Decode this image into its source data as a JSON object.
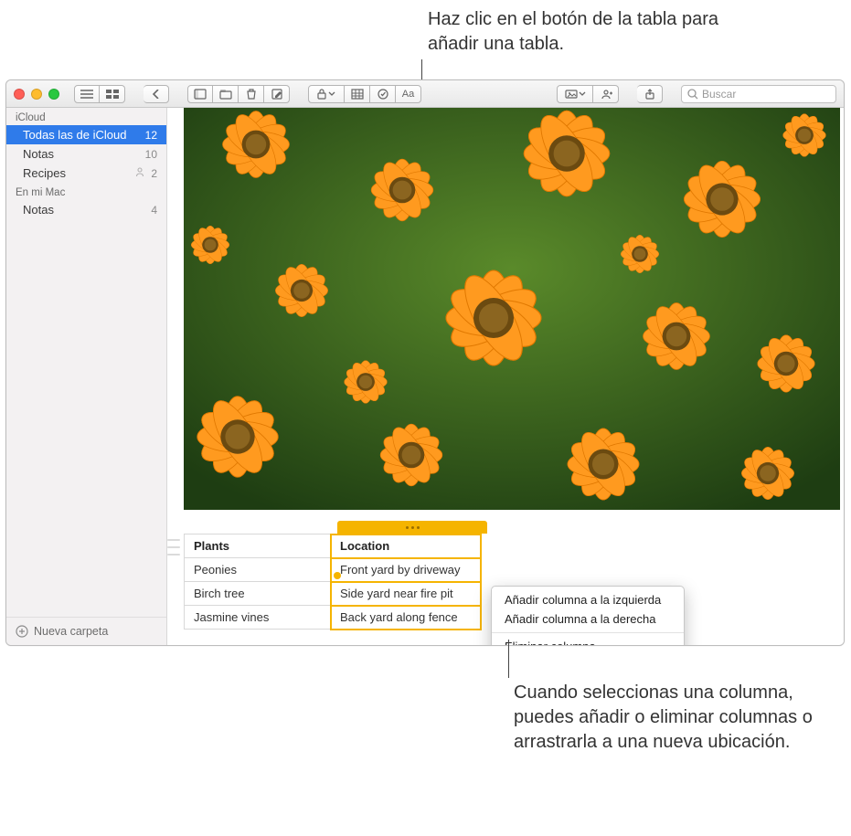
{
  "callouts": {
    "top": "Haz clic en el botón de la tabla para añadir una tabla.",
    "bottom": "Cuando seleccionas una columna, puedes añadir o eliminar columnas o arrastrarla a una nueva ubicación."
  },
  "toolbar": {
    "search_placeholder": "Buscar"
  },
  "sidebar": {
    "sections": [
      {
        "title": "iCloud",
        "items": [
          {
            "label": "Todas las de iCloud",
            "count": "12",
            "selected": true
          },
          {
            "label": "Notas",
            "count": "10"
          },
          {
            "label": "Recipes",
            "count": "2",
            "shared": true
          }
        ]
      },
      {
        "title": "En mi Mac",
        "items": [
          {
            "label": "Notas",
            "count": "4"
          }
        ]
      }
    ],
    "new_folder": "Nueva carpeta"
  },
  "note_table": {
    "headers": [
      "Plants",
      "Location"
    ],
    "rows": [
      [
        "Peonies",
        "Front yard by driveway"
      ],
      [
        "Birch tree",
        "Side yard near fire pit"
      ],
      [
        "Jasmine vines",
        "Back yard along fence"
      ]
    ]
  },
  "context_menu": {
    "add_left": "Añadir columna a la izquierda",
    "add_right": "Añadir columna a la derecha",
    "delete": "Eliminar columna"
  }
}
